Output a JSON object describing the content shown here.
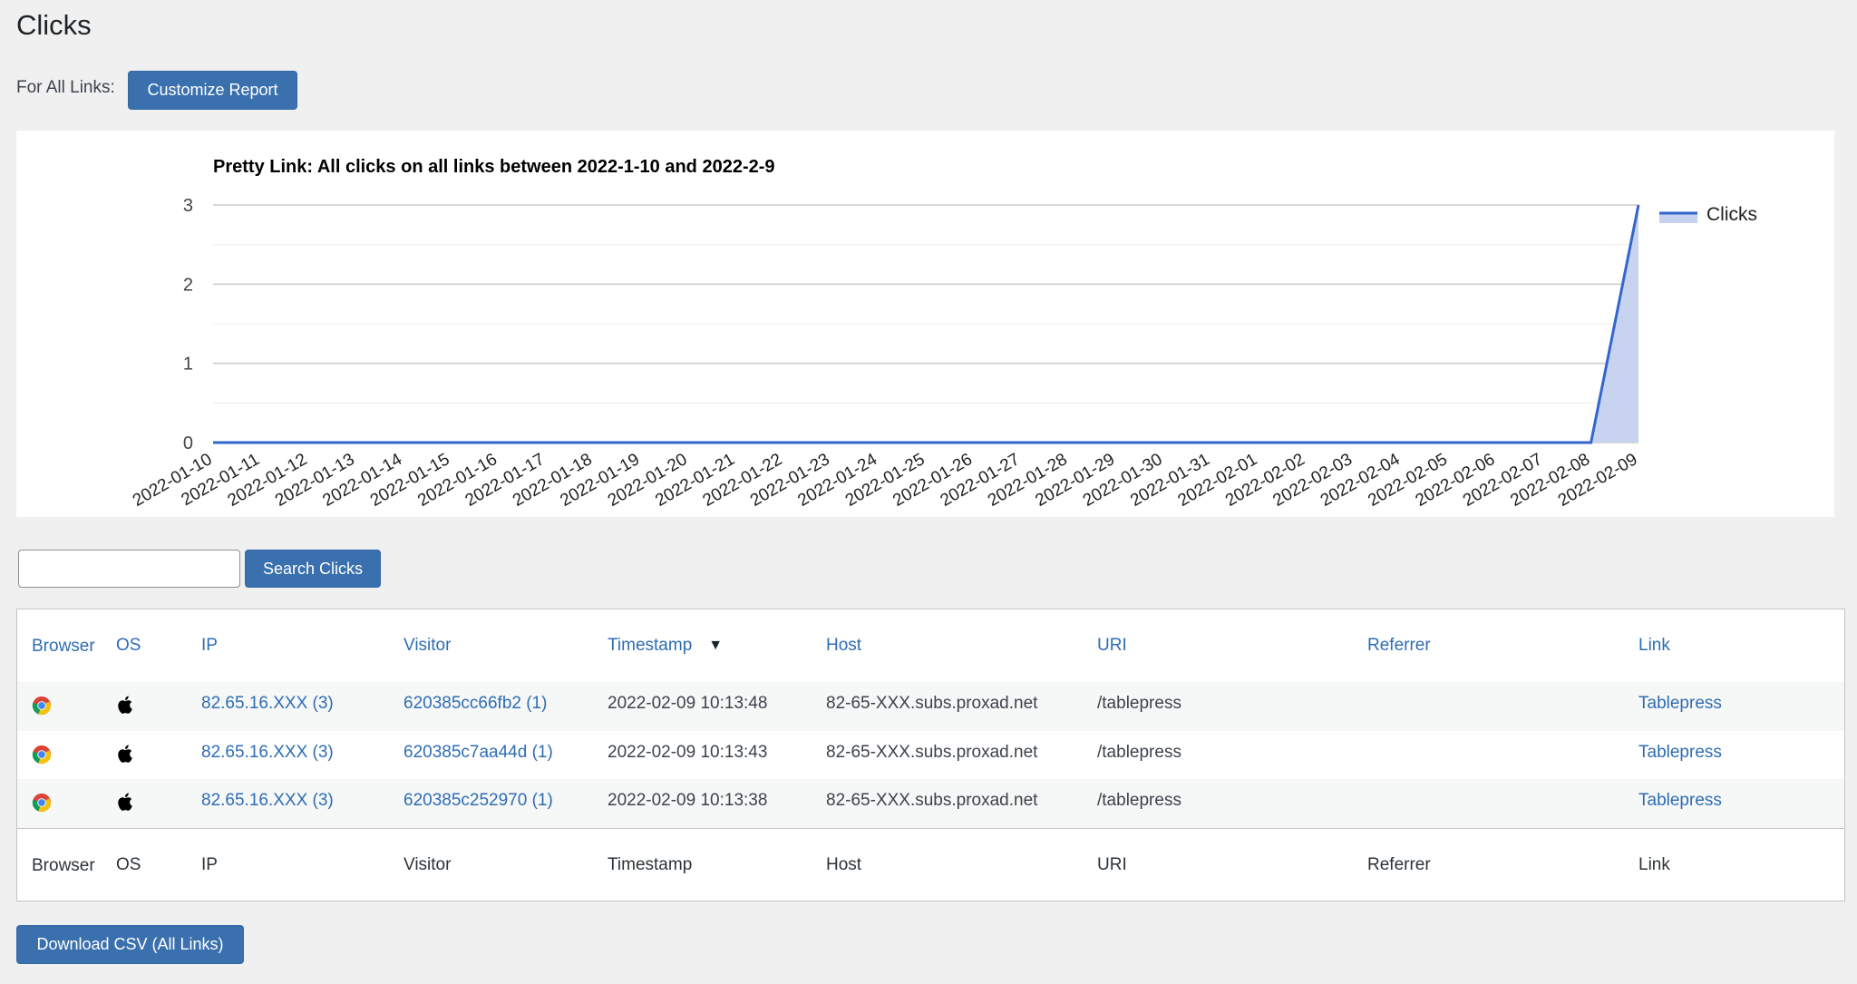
{
  "page": {
    "title": "Clicks",
    "for_all_links_label": "For All Links:",
    "customize_report_label": "Customize Report"
  },
  "chart_data": {
    "type": "area",
    "title": "Pretty Link: All clicks on all links between 2022-1-10 and 2022-2-9",
    "xlabel": "",
    "ylabel": "",
    "ylim": [
      0,
      3
    ],
    "yticks": [
      "0",
      "1",
      "2",
      "3"
    ],
    "grid": true,
    "legend": "right",
    "colors": {
      "line": "#3366cc",
      "fill": "#c5d1ee"
    },
    "x": [
      "2022-01-10",
      "2022-01-11",
      "2022-01-12",
      "2022-01-13",
      "2022-01-14",
      "2022-01-15",
      "2022-01-16",
      "2022-01-17",
      "2022-01-18",
      "2022-01-19",
      "2022-01-20",
      "2022-01-21",
      "2022-01-22",
      "2022-01-23",
      "2022-01-24",
      "2022-01-25",
      "2022-01-26",
      "2022-01-27",
      "2022-01-28",
      "2022-01-29",
      "2022-01-30",
      "2022-01-31",
      "2022-02-01",
      "2022-02-02",
      "2022-02-03",
      "2022-02-04",
      "2022-02-05",
      "2022-02-06",
      "2022-02-07",
      "2022-02-08",
      "2022-02-09"
    ],
    "series": [
      {
        "name": "Clicks",
        "values": [
          0,
          0,
          0,
          0,
          0,
          0,
          0,
          0,
          0,
          0,
          0,
          0,
          0,
          0,
          0,
          0,
          0,
          0,
          0,
          0,
          0,
          0,
          0,
          0,
          0,
          0,
          0,
          0,
          0,
          0,
          3
        ]
      }
    ]
  },
  "search": {
    "value": "",
    "placeholder": "",
    "button_label": "Search Clicks"
  },
  "table": {
    "columns": {
      "browser": "Browser",
      "os": "OS",
      "ip": "IP",
      "visitor": "Visitor",
      "timestamp": "Timestamp",
      "host": "Host",
      "uri": "URI",
      "referrer": "Referrer",
      "link": "Link"
    },
    "sort_indicator": "▼",
    "rows": [
      {
        "browser_icon": "chrome-icon",
        "os_icon": "apple-icon",
        "ip": "82.65.16.XXX (3)",
        "visitor": "620385cc66fb2 (1)",
        "timestamp": "2022-02-09 10:13:48",
        "host": "82-65-XXX.subs.proxad.net",
        "uri": "/tablepress",
        "referrer": "",
        "link": "Tablepress"
      },
      {
        "browser_icon": "chrome-icon",
        "os_icon": "apple-icon",
        "ip": "82.65.16.XXX (3)",
        "visitor": "620385c7aa44d (1)",
        "timestamp": "2022-02-09 10:13:43",
        "host": "82-65-XXX.subs.proxad.net",
        "uri": "/tablepress",
        "referrer": "",
        "link": "Tablepress"
      },
      {
        "browser_icon": "chrome-icon",
        "os_icon": "apple-icon",
        "ip": "82.65.16.XXX (3)",
        "visitor": "620385c252970 (1)",
        "timestamp": "2022-02-09 10:13:38",
        "host": "82-65-XXX.subs.proxad.net",
        "uri": "/tablepress",
        "referrer": "",
        "link": "Tablepress"
      }
    ]
  },
  "download_csv_label": "Download CSV (All Links)"
}
